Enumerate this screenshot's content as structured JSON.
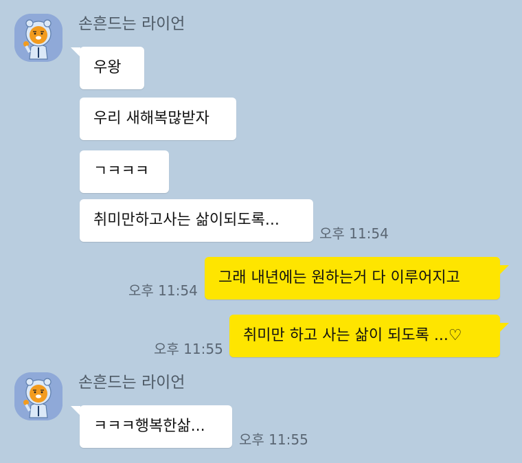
{
  "chat": {
    "sender_name": "손흔드는 라이언",
    "group1": {
      "messages": [
        "우왕",
        "우리 새해복많받자",
        "ㄱㅋㅋㅋ",
        "취미만하고사는 삶이되도록..."
      ],
      "time": "오후 11:54"
    },
    "mine1": {
      "text": "그래 내년에는 원하는거 다 이루어지고",
      "time": "오후 11:54"
    },
    "mine2": {
      "text": "취미만 하고 사는 삶이 되도록 ...♡",
      "time": "오후 11:55"
    },
    "group2": {
      "messages": [
        "ㅋㅋㅋ행복한삶..."
      ],
      "time": "오후 11:55"
    }
  },
  "colors": {
    "background": "#b9cddf",
    "incoming_bubble": "#ffffff",
    "outgoing_bubble": "#fee500",
    "avatar_bg": "#8fa9d8"
  },
  "icons": {
    "avatar": "ryan-character-icon"
  }
}
